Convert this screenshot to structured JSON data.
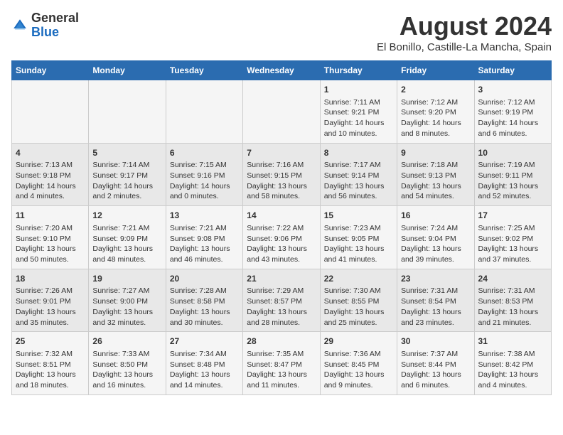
{
  "logo": {
    "text_general": "General",
    "text_blue": "Blue"
  },
  "header": {
    "title": "August 2024",
    "subtitle": "El Bonillo, Castille-La Mancha, Spain"
  },
  "columns": [
    "Sunday",
    "Monday",
    "Tuesday",
    "Wednesday",
    "Thursday",
    "Friday",
    "Saturday"
  ],
  "weeks": [
    {
      "days": [
        {
          "num": "",
          "lines": []
        },
        {
          "num": "",
          "lines": []
        },
        {
          "num": "",
          "lines": []
        },
        {
          "num": "",
          "lines": []
        },
        {
          "num": "1",
          "lines": [
            "Sunrise: 7:11 AM",
            "Sunset: 9:21 PM",
            "Daylight: 14 hours",
            "and 10 minutes."
          ]
        },
        {
          "num": "2",
          "lines": [
            "Sunrise: 7:12 AM",
            "Sunset: 9:20 PM",
            "Daylight: 14 hours",
            "and 8 minutes."
          ]
        },
        {
          "num": "3",
          "lines": [
            "Sunrise: 7:12 AM",
            "Sunset: 9:19 PM",
            "Daylight: 14 hours",
            "and 6 minutes."
          ]
        }
      ]
    },
    {
      "days": [
        {
          "num": "4",
          "lines": [
            "Sunrise: 7:13 AM",
            "Sunset: 9:18 PM",
            "Daylight: 14 hours",
            "and 4 minutes."
          ]
        },
        {
          "num": "5",
          "lines": [
            "Sunrise: 7:14 AM",
            "Sunset: 9:17 PM",
            "Daylight: 14 hours",
            "and 2 minutes."
          ]
        },
        {
          "num": "6",
          "lines": [
            "Sunrise: 7:15 AM",
            "Sunset: 9:16 PM",
            "Daylight: 14 hours",
            "and 0 minutes."
          ]
        },
        {
          "num": "7",
          "lines": [
            "Sunrise: 7:16 AM",
            "Sunset: 9:15 PM",
            "Daylight: 13 hours",
            "and 58 minutes."
          ]
        },
        {
          "num": "8",
          "lines": [
            "Sunrise: 7:17 AM",
            "Sunset: 9:14 PM",
            "Daylight: 13 hours",
            "and 56 minutes."
          ]
        },
        {
          "num": "9",
          "lines": [
            "Sunrise: 7:18 AM",
            "Sunset: 9:13 PM",
            "Daylight: 13 hours",
            "and 54 minutes."
          ]
        },
        {
          "num": "10",
          "lines": [
            "Sunrise: 7:19 AM",
            "Sunset: 9:11 PM",
            "Daylight: 13 hours",
            "and 52 minutes."
          ]
        }
      ]
    },
    {
      "days": [
        {
          "num": "11",
          "lines": [
            "Sunrise: 7:20 AM",
            "Sunset: 9:10 PM",
            "Daylight: 13 hours",
            "and 50 minutes."
          ]
        },
        {
          "num": "12",
          "lines": [
            "Sunrise: 7:21 AM",
            "Sunset: 9:09 PM",
            "Daylight: 13 hours",
            "and 48 minutes."
          ]
        },
        {
          "num": "13",
          "lines": [
            "Sunrise: 7:21 AM",
            "Sunset: 9:08 PM",
            "Daylight: 13 hours",
            "and 46 minutes."
          ]
        },
        {
          "num": "14",
          "lines": [
            "Sunrise: 7:22 AM",
            "Sunset: 9:06 PM",
            "Daylight: 13 hours",
            "and 43 minutes."
          ]
        },
        {
          "num": "15",
          "lines": [
            "Sunrise: 7:23 AM",
            "Sunset: 9:05 PM",
            "Daylight: 13 hours",
            "and 41 minutes."
          ]
        },
        {
          "num": "16",
          "lines": [
            "Sunrise: 7:24 AM",
            "Sunset: 9:04 PM",
            "Daylight: 13 hours",
            "and 39 minutes."
          ]
        },
        {
          "num": "17",
          "lines": [
            "Sunrise: 7:25 AM",
            "Sunset: 9:02 PM",
            "Daylight: 13 hours",
            "and 37 minutes."
          ]
        }
      ]
    },
    {
      "days": [
        {
          "num": "18",
          "lines": [
            "Sunrise: 7:26 AM",
            "Sunset: 9:01 PM",
            "Daylight: 13 hours",
            "and 35 minutes."
          ]
        },
        {
          "num": "19",
          "lines": [
            "Sunrise: 7:27 AM",
            "Sunset: 9:00 PM",
            "Daylight: 13 hours",
            "and 32 minutes."
          ]
        },
        {
          "num": "20",
          "lines": [
            "Sunrise: 7:28 AM",
            "Sunset: 8:58 PM",
            "Daylight: 13 hours",
            "and 30 minutes."
          ]
        },
        {
          "num": "21",
          "lines": [
            "Sunrise: 7:29 AM",
            "Sunset: 8:57 PM",
            "Daylight: 13 hours",
            "and 28 minutes."
          ]
        },
        {
          "num": "22",
          "lines": [
            "Sunrise: 7:30 AM",
            "Sunset: 8:55 PM",
            "Daylight: 13 hours",
            "and 25 minutes."
          ]
        },
        {
          "num": "23",
          "lines": [
            "Sunrise: 7:31 AM",
            "Sunset: 8:54 PM",
            "Daylight: 13 hours",
            "and 23 minutes."
          ]
        },
        {
          "num": "24",
          "lines": [
            "Sunrise: 7:31 AM",
            "Sunset: 8:53 PM",
            "Daylight: 13 hours",
            "and 21 minutes."
          ]
        }
      ]
    },
    {
      "days": [
        {
          "num": "25",
          "lines": [
            "Sunrise: 7:32 AM",
            "Sunset: 8:51 PM",
            "Daylight: 13 hours",
            "and 18 minutes."
          ]
        },
        {
          "num": "26",
          "lines": [
            "Sunrise: 7:33 AM",
            "Sunset: 8:50 PM",
            "Daylight: 13 hours",
            "and 16 minutes."
          ]
        },
        {
          "num": "27",
          "lines": [
            "Sunrise: 7:34 AM",
            "Sunset: 8:48 PM",
            "Daylight: 13 hours",
            "and 14 minutes."
          ]
        },
        {
          "num": "28",
          "lines": [
            "Sunrise: 7:35 AM",
            "Sunset: 8:47 PM",
            "Daylight: 13 hours",
            "and 11 minutes."
          ]
        },
        {
          "num": "29",
          "lines": [
            "Sunrise: 7:36 AM",
            "Sunset: 8:45 PM",
            "Daylight: 13 hours",
            "and 9 minutes."
          ]
        },
        {
          "num": "30",
          "lines": [
            "Sunrise: 7:37 AM",
            "Sunset: 8:44 PM",
            "Daylight: 13 hours",
            "and 6 minutes."
          ]
        },
        {
          "num": "31",
          "lines": [
            "Sunrise: 7:38 AM",
            "Sunset: 8:42 PM",
            "Daylight: 13 hours",
            "and 4 minutes."
          ]
        }
      ]
    }
  ]
}
